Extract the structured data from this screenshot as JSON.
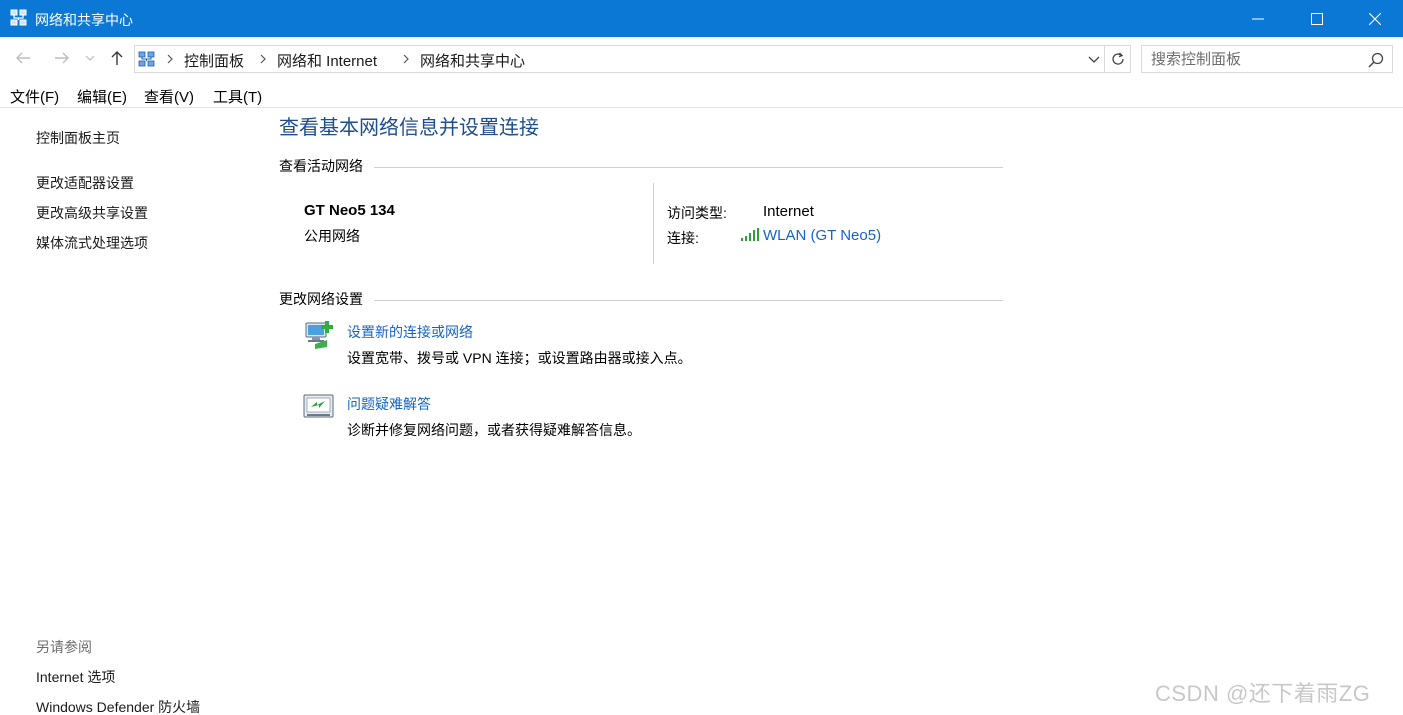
{
  "window": {
    "title": "网络和共享中心"
  },
  "address_bar": {
    "crumbs": [
      "控制面板",
      "网络和 Internet",
      "网络和共享中心"
    ]
  },
  "search": {
    "placeholder": "搜索控制面板"
  },
  "menu": [
    "文件(F)",
    "编辑(E)",
    "查看(V)",
    "工具(T)"
  ],
  "left_pane": {
    "home": "控制面板主页",
    "links": [
      "更改适配器设置",
      "更改高级共享设置",
      "媒体流式处理选项"
    ],
    "see_also_title": "另请参阅",
    "see_also": [
      "Internet 选项",
      "Windows Defender 防火墙"
    ]
  },
  "main": {
    "title": "查看基本网络信息并设置连接",
    "active_networks_header": "查看活动网络",
    "network": {
      "name": "GT Neo5 134",
      "category": "公用网络",
      "access_type_label": "访问类型:",
      "access_type_value": "Internet",
      "connection_label": "连接:",
      "connection_value": "WLAN (GT Neo5)"
    },
    "change_settings_header": "更改网络设置",
    "tasks": [
      {
        "link": "设置新的连接或网络",
        "desc": "设置宽带、拨号或 VPN 连接；或设置路由器或接入点。",
        "icon": "new-connection-icon"
      },
      {
        "link": "问题疑难解答",
        "desc": "诊断并修复网络问题，或者获得疑难解答信息。",
        "icon": "troubleshoot-icon"
      }
    ]
  },
  "watermark": "CSDN @还下着雨ZG",
  "colors": {
    "titlebar": "#0a78d4",
    "link": "#1464c8",
    "heading": "#1e4e8c"
  }
}
